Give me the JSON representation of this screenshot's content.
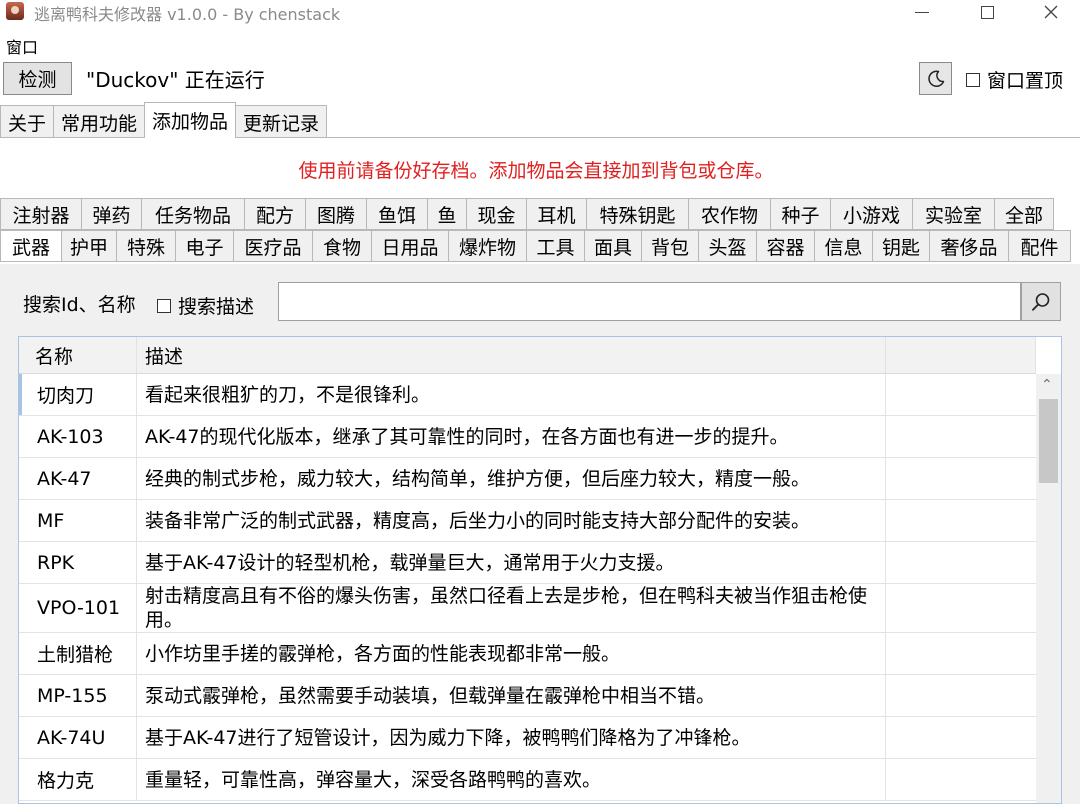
{
  "window": {
    "title": "逃离鸭科夫修改器 v1.0.0 - By chenstack"
  },
  "menu": {
    "items": [
      "窗口"
    ]
  },
  "toolbar": {
    "detect_label": "检测",
    "status": "\"Duckov\" 正在运行",
    "pin_label": "窗口置顶",
    "pin_checked": false
  },
  "tabs": [
    {
      "label": "关于",
      "active": false
    },
    {
      "label": "常用功能",
      "active": false
    },
    {
      "label": "添加物品",
      "active": true
    },
    {
      "label": "更新记录",
      "active": false
    }
  ],
  "warning": "使用前请备份好存档。添加物品会直接加到背包或仓库。",
  "categories": {
    "row1": [
      "注射器",
      "弹药",
      "任务物品",
      "配方",
      "图腾",
      "鱼饵",
      "鱼",
      "现金",
      "耳机",
      "特殊钥匙",
      "农作物",
      "种子",
      "小游戏",
      "实验室",
      "全部"
    ],
    "row2": [
      "武器",
      "护甲",
      "特殊",
      "电子",
      "医疗品",
      "食物",
      "日用品",
      "爆炸物",
      "工具",
      "面具",
      "背包",
      "头盔",
      "容器",
      "信息",
      "钥匙",
      "奢侈品",
      "配件"
    ],
    "active": "武器"
  },
  "search": {
    "label": "搜索Id、名称",
    "desc_label": "搜索描述",
    "desc_checked": false,
    "value": "",
    "placeholder": ""
  },
  "table": {
    "headers": [
      "名称",
      "描述",
      ""
    ],
    "rows": [
      {
        "name": "切肉刀",
        "desc": "看起来很粗犷的刀，不是很锋利。"
      },
      {
        "name": "AK-103",
        "desc": "AK-47的现代化版本，继承了其可靠性的同时，在各方面也有进一步的提升。"
      },
      {
        "name": "AK-47",
        "desc": "经典的制式步枪，威力较大，结构简单，维护方便，但后座力较大，精度一般。"
      },
      {
        "name": "MF",
        "desc": "装备非常广泛的制式武器，精度高，后坐力小的同时能支持大部分配件的安装。"
      },
      {
        "name": "RPK",
        "desc": "基于AK-47设计的轻型机枪，载弹量巨大，通常用于火力支援。"
      },
      {
        "name": "VPO-101",
        "desc": "射击精度高且有不俗的爆头伤害，虽然口径看上去是步枪，但在鸭科夫被当作狙击枪使用。"
      },
      {
        "name": "土制猎枪",
        "desc": "小作坊里手搓的霰弹枪，各方面的性能表现都非常一般。"
      },
      {
        "name": "MP-155",
        "desc": "泵动式霰弹枪，虽然需要手动装填，但载弹量在霰弹枪中相当不错。"
      },
      {
        "name": "AK-74U",
        "desc": "基于AK-47进行了短管设计，因为威力下降，被鸭鸭们降格为了冲锋枪。"
      },
      {
        "name": "格力克",
        "desc": "重量轻，可靠性高，弹容量大，深受各路鸭鸭的喜欢。"
      }
    ]
  },
  "icons": {
    "app": "duck-app-icon",
    "theme": "moon-icon",
    "search": "magnifier-icon"
  }
}
